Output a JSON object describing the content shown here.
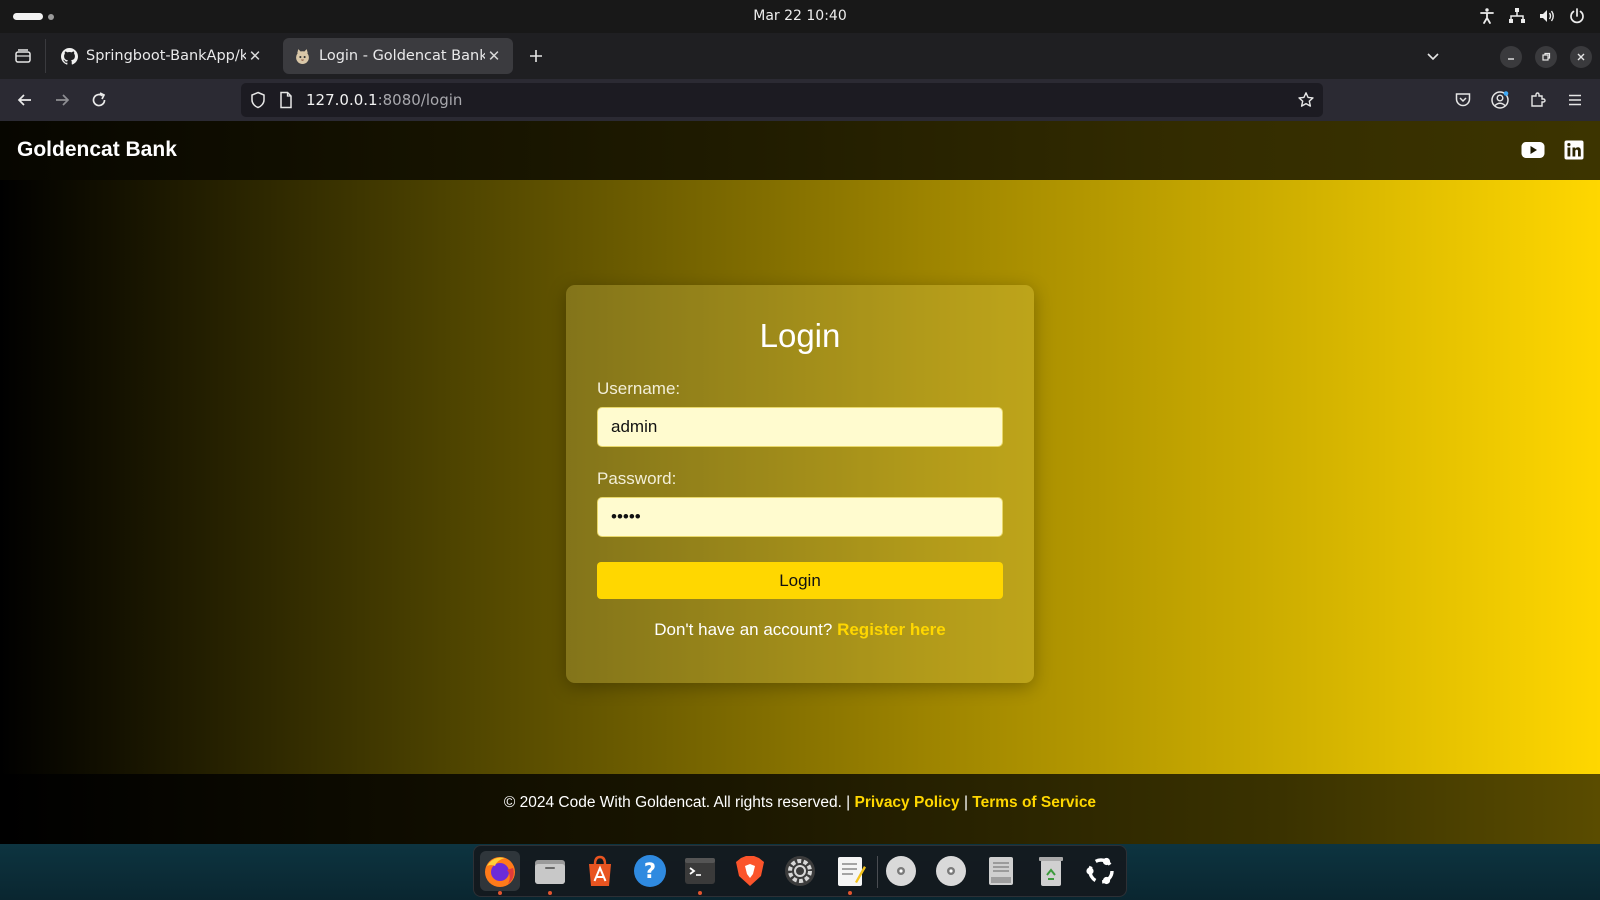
{
  "os": {
    "clock": "Mar 22  10:40"
  },
  "browser": {
    "tabs": [
      {
        "title": "Springboot-BankApp/kub",
        "favicon": "github-icon",
        "active": false
      },
      {
        "title": "Login - Goldencat Bank",
        "favicon": "cat-icon",
        "active": true
      }
    ],
    "url_host": "127.0.0.1",
    "url_rest": ":8080/login"
  },
  "site": {
    "brand": "Goldencat Bank",
    "social": [
      "youtube-icon",
      "linkedin-icon"
    ]
  },
  "login": {
    "title": "Login",
    "username_label": "Username:",
    "username_value": "admin",
    "password_label": "Password:",
    "password_value": "•••••",
    "button": "Login",
    "register_prompt": "Don't have an account? ",
    "register_link": "Register here"
  },
  "footer": {
    "copyright": "© 2024 Code With Goldencat. All rights reserved. | ",
    "privacy": "Privacy Policy",
    "separator": " | ",
    "terms": "Terms of Service"
  },
  "colors": {
    "accent_gold": "#ffd700",
    "input_bg": "#fffbcf"
  },
  "dock_icons": [
    "firefox-icon",
    "files-icon",
    "app-center-icon",
    "help-icon",
    "terminal-icon",
    "brave-icon",
    "settings-icon",
    "text-editor-icon",
    "disc-icon",
    "disc-icon",
    "save-icon",
    "trash-icon",
    "ubuntu-icon"
  ]
}
